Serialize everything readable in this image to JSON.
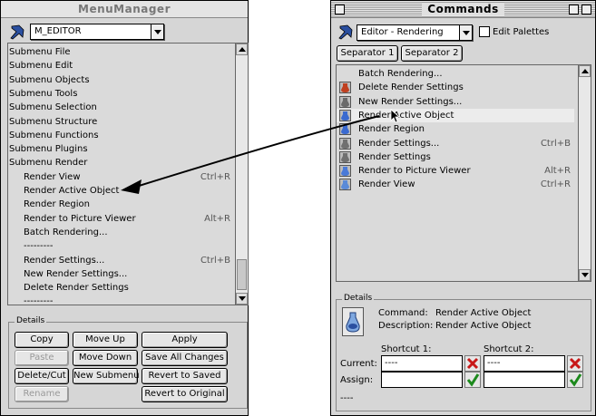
{
  "menu_manager": {
    "title": "MenuManager",
    "menu_select": "M_EDITOR",
    "items": [
      {
        "label": "Submenu File",
        "shortcut": ""
      },
      {
        "label": "Submenu Edit",
        "shortcut": ""
      },
      {
        "label": "Submenu Objects",
        "shortcut": ""
      },
      {
        "label": "Submenu Tools",
        "shortcut": ""
      },
      {
        "label": "Submenu Selection",
        "shortcut": ""
      },
      {
        "label": "Submenu Structure",
        "shortcut": ""
      },
      {
        "label": "Submenu Functions",
        "shortcut": ""
      },
      {
        "label": "Submenu Plugins",
        "shortcut": ""
      },
      {
        "label": "Submenu Render",
        "shortcut": ""
      },
      {
        "label": "Render View",
        "shortcut": "Ctrl+R"
      },
      {
        "label": "Render Active Object",
        "shortcut": ""
      },
      {
        "label": "Render Region",
        "shortcut": ""
      },
      {
        "label": "Render to Picture Viewer",
        "shortcut": "Alt+R"
      },
      {
        "label": "Batch Rendering...",
        "shortcut": ""
      },
      {
        "label": "---------",
        "shortcut": ""
      },
      {
        "label": "Render Settings...",
        "shortcut": "Ctrl+B"
      },
      {
        "label": "New Render Settings...",
        "shortcut": ""
      },
      {
        "label": "Delete Render Settings",
        "shortcut": ""
      },
      {
        "label": "---------",
        "shortcut": ""
      }
    ],
    "details_label": "Details",
    "buttons": {
      "copy": "Copy",
      "move_up": "Move Up",
      "apply": "Apply",
      "paste": "Paste",
      "move_down": "Move Down",
      "save_all": "Save All Changes",
      "delete_cut": "Delete/Cut",
      "new_submenu": "New Submenu",
      "revert_saved": "Revert to Saved",
      "rename": "Rename",
      "revert_original": "Revert to Original"
    }
  },
  "commands": {
    "title": "Commands",
    "category_select": "Editor - Rendering",
    "edit_palettes": "Edit Palettes",
    "edit_palettes_checked": false,
    "separator1": "Separator 1",
    "separator2": "Separator 2",
    "items": [
      {
        "label": "Batch Rendering...",
        "shortcut": "",
        "icon": "none"
      },
      {
        "label": "Delete Render Settings",
        "shortcut": "",
        "icon": "delete-render-settings-icon"
      },
      {
        "label": "New Render Settings...",
        "shortcut": "",
        "icon": "new-render-settings-icon"
      },
      {
        "label": "Render Active Object",
        "shortcut": "",
        "icon": "render-active-object-icon"
      },
      {
        "label": "Render Region",
        "shortcut": "",
        "icon": "render-region-icon"
      },
      {
        "label": "Render Settings...",
        "shortcut": "Ctrl+B",
        "icon": "render-settings-icon"
      },
      {
        "label": "Render Settings",
        "shortcut": "",
        "icon": "render-settings-icon"
      },
      {
        "label": "Render to Picture Viewer",
        "shortcut": "Alt+R",
        "icon": "picture-viewer-icon"
      },
      {
        "label": "Render View",
        "shortcut": "Ctrl+R",
        "icon": "render-view-icon"
      }
    ],
    "details_label": "Details",
    "command_label": "Command:",
    "command_value": "Render Active Object",
    "description_label": "Description:",
    "description_value": "Render Active Object",
    "shortcut1_label": "Shortcut 1:",
    "shortcut2_label": "Shortcut 2:",
    "current_label": "Current:",
    "assign_label": "Assign:",
    "current1": "----",
    "current2": "----",
    "footer": "----"
  },
  "colors": {
    "selected_row": "#ececec",
    "accent_blue": "#2a4fa0",
    "ok_green": "#1c8a1c",
    "bad_red": "#c81818",
    "arrow": "#000000"
  }
}
